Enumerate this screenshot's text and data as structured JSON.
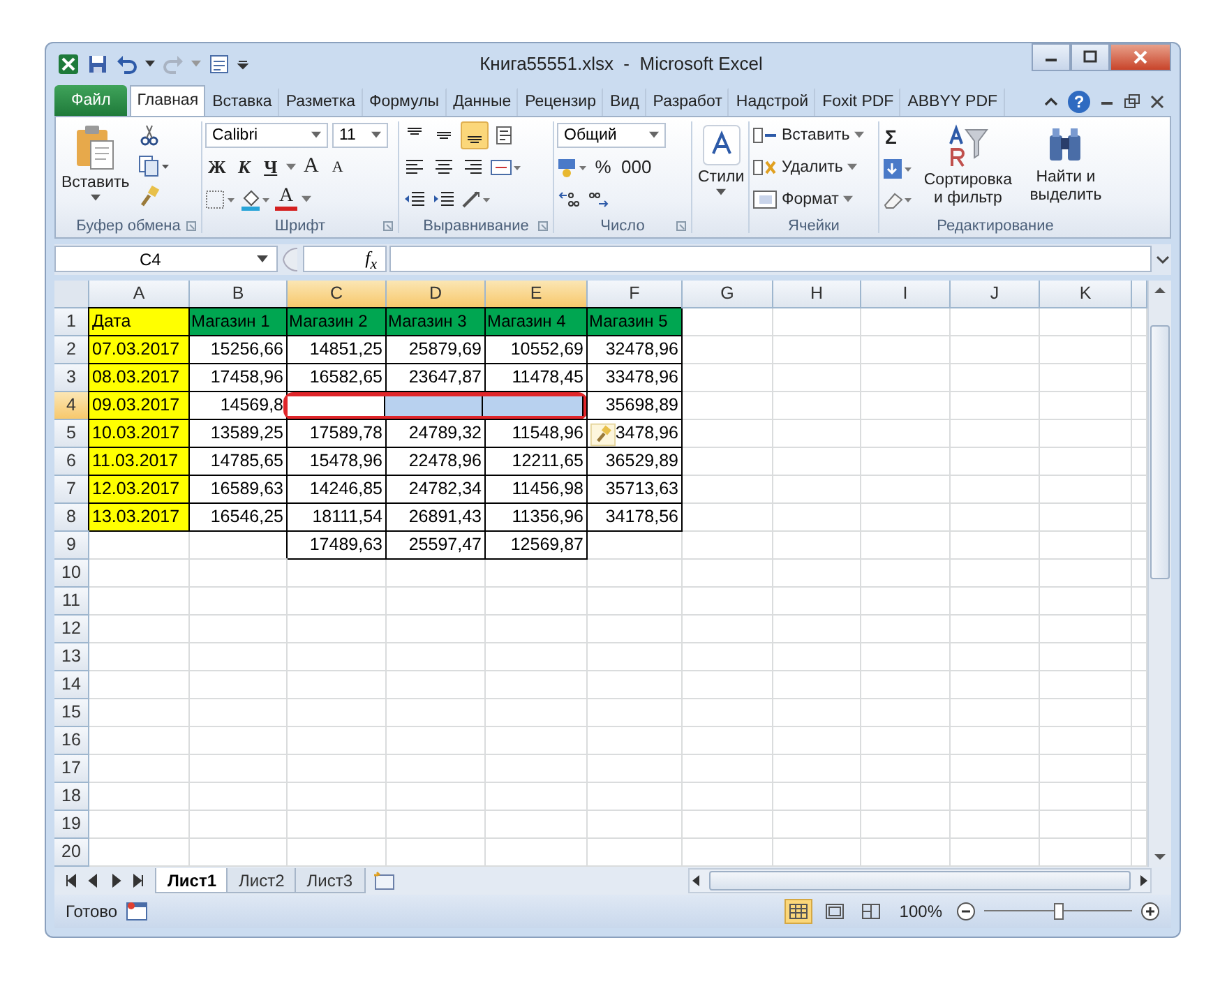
{
  "window": {
    "title": "Книга55551.xlsx  -  Microsoft Excel",
    "help": "?"
  },
  "ribbon_tabs": [
    {
      "label": "Файл",
      "kind": "file",
      "selected": false
    },
    {
      "label": "Главная",
      "kind": "tab",
      "selected": true
    },
    {
      "label": "Вставка",
      "kind": "tab",
      "selected": false
    },
    {
      "label": "Разметка",
      "kind": "tab",
      "selected": false
    },
    {
      "label": "Формулы",
      "kind": "tab",
      "selected": false
    },
    {
      "label": "Данные",
      "kind": "tab",
      "selected": false
    },
    {
      "label": "Рецензир",
      "kind": "tab",
      "selected": false
    },
    {
      "label": "Вид",
      "kind": "tab",
      "selected": false
    },
    {
      "label": "Разработ",
      "kind": "tab",
      "selected": false
    },
    {
      "label": "Надстрой",
      "kind": "tab",
      "selected": false
    },
    {
      "label": "Foxit PDF",
      "kind": "tab",
      "selected": false
    },
    {
      "label": "ABBYY PDF",
      "kind": "tab",
      "selected": false
    }
  ],
  "ribbon": {
    "clipboard": {
      "paste": "Вставить",
      "label": "Буфер обмена"
    },
    "font": {
      "name": "Calibri",
      "size": "11",
      "bold": "Ж",
      "italic": "К",
      "underline": "Ч",
      "grow": "A",
      "shrink": "A",
      "font_color_button": "A",
      "label": "Шрифт"
    },
    "alignment": {
      "label": "Выравнивание"
    },
    "number": {
      "format": "Общий",
      "percent": "%",
      "thousands": "000",
      "label": "Число"
    },
    "styles": {
      "button": "Стили"
    },
    "cells": {
      "insert": "Вставить",
      "delete": "Удалить",
      "format": "Формат",
      "label": "Ячейки"
    },
    "editing": {
      "sum": "Σ",
      "sort": "Сортировка и фильтр",
      "find": "Найти и выделить",
      "label": "Редактирование"
    }
  },
  "formula_bar": {
    "name_box": "C4",
    "fx": "f$_{x}$"
  },
  "sheet": {
    "columns": [
      {
        "label": "A",
        "selected": false
      },
      {
        "label": "B",
        "selected": false
      },
      {
        "label": "C",
        "selected": true
      },
      {
        "label": "D",
        "selected": true
      },
      {
        "label": "E",
        "selected": true
      },
      {
        "label": "F",
        "selected": false
      },
      {
        "label": "G",
        "selected": false
      },
      {
        "label": "H",
        "selected": false
      },
      {
        "label": "I",
        "selected": false
      },
      {
        "label": "J",
        "selected": false
      },
      {
        "label": "K",
        "selected": false
      }
    ],
    "rows": [
      {
        "number": "1",
        "selected": false,
        "cells": [
          {
            "text": "Дата",
            "kind": "date",
            "selected": false
          },
          {
            "text": "Магазин 1",
            "kind": "header",
            "selected": false
          },
          {
            "text": "Магазин 2",
            "kind": "header",
            "selected": false
          },
          {
            "text": "Магазин 3",
            "kind": "header",
            "selected": false
          },
          {
            "text": "Магазин 4",
            "kind": "header",
            "selected": false
          },
          {
            "text": "Магазин 5",
            "kind": "header",
            "selected": false
          }
        ]
      },
      {
        "number": "2",
        "selected": false,
        "cells": [
          {
            "text": "07.03.2017",
            "kind": "date",
            "selected": false
          },
          {
            "text": "15256,66",
            "kind": "number",
            "selected": false
          },
          {
            "text": "14851,25",
            "kind": "number",
            "selected": false
          },
          {
            "text": "25879,69",
            "kind": "number",
            "selected": false
          },
          {
            "text": "10552,69",
            "kind": "number",
            "selected": false
          },
          {
            "text": "32478,96",
            "kind": "number",
            "selected": false
          }
        ]
      },
      {
        "number": "3",
        "selected": false,
        "cells": [
          {
            "text": "08.03.2017",
            "kind": "date",
            "selected": false
          },
          {
            "text": "17458,96",
            "kind": "number",
            "selected": false
          },
          {
            "text": "16582,65",
            "kind": "number",
            "selected": false
          },
          {
            "text": "23647,87",
            "kind": "number",
            "selected": false
          },
          {
            "text": "11478,45",
            "kind": "number",
            "selected": false
          },
          {
            "text": "33478,96",
            "kind": "number",
            "selected": false
          }
        ]
      },
      {
        "number": "4",
        "selected": true,
        "cells": [
          {
            "text": "09.03.2017",
            "kind": "date",
            "selected": false
          },
          {
            "text": "14569,8",
            "kind": "number",
            "selected": false
          },
          {
            "kind": "active",
            "selected": true
          },
          {
            "kind": "number",
            "selected": true
          },
          {
            "kind": "number",
            "selected": true
          },
          {
            "text": "35698,89",
            "kind": "number",
            "selected": false
          }
        ]
      },
      {
        "number": "5",
        "selected": false,
        "cells": [
          {
            "text": "10.03.2017",
            "kind": "date",
            "selected": false
          },
          {
            "text": "13589,25",
            "kind": "number",
            "selected": false
          },
          {
            "text": "17589,78",
            "kind": "number",
            "selected": false
          },
          {
            "text": "24789,32",
            "kind": "number",
            "selected": false
          },
          {
            "text": "11548,96",
            "kind": "number",
            "selected": false
          },
          {
            "text": "3478,96",
            "kind": "number",
            "selected": false
          }
        ]
      },
      {
        "number": "6",
        "selected": false,
        "cells": [
          {
            "text": "11.03.2017",
            "kind": "date",
            "selected": false
          },
          {
            "text": "14785,65",
            "kind": "number",
            "selected": false
          },
          {
            "text": "15478,96",
            "kind": "number",
            "selected": false
          },
          {
            "text": "22478,96",
            "kind": "number",
            "selected": false
          },
          {
            "text": "12211,65",
            "kind": "number",
            "selected": false
          },
          {
            "text": "36529,89",
            "kind": "number",
            "selected": false
          }
        ]
      },
      {
        "number": "7",
        "selected": false,
        "cells": [
          {
            "text": "12.03.2017",
            "kind": "date",
            "selected": false
          },
          {
            "text": "16589,63",
            "kind": "number",
            "selected": false
          },
          {
            "text": "14246,85",
            "kind": "number",
            "selected": false
          },
          {
            "text": "24782,34",
            "kind": "number",
            "selected": false
          },
          {
            "text": "11456,98",
            "kind": "number",
            "selected": false
          },
          {
            "text": "35713,63",
            "kind": "number",
            "selected": false
          }
        ]
      },
      {
        "number": "8",
        "selected": false,
        "cells": [
          {
            "text": "13.03.2017",
            "kind": "date",
            "selected": false
          },
          {
            "text": "16546,25",
            "kind": "number",
            "selected": false
          },
          {
            "text": "18111,54",
            "kind": "number",
            "selected": false
          },
          {
            "text": "26891,43",
            "kind": "number",
            "selected": false
          },
          {
            "text": "11356,96",
            "kind": "number",
            "selected": false
          },
          {
            "text": "34178,56",
            "kind": "number",
            "selected": false
          }
        ]
      },
      {
        "number": "9",
        "selected": false,
        "cells": [
          {
            "kind": "blank",
            "selected": false
          },
          {
            "kind": "blank",
            "selected": false
          },
          {
            "text": "17489,63",
            "kind": "number",
            "selected": false
          },
          {
            "text": "25597,47",
            "kind": "number",
            "selected": false
          },
          {
            "text": "12569,87",
            "kind": "number",
            "selected": false
          }
        ]
      },
      {
        "number": "10",
        "selected": false
      },
      {
        "number": "11",
        "selected": false
      },
      {
        "number": "12",
        "selected": false
      },
      {
        "number": "13",
        "selected": false
      },
      {
        "number": "14",
        "selected": false
      },
      {
        "number": "15",
        "selected": false
      },
      {
        "number": "16",
        "selected": false
      },
      {
        "number": "17",
        "selected": false
      },
      {
        "number": "18",
        "selected": false
      },
      {
        "number": "19",
        "selected": false
      },
      {
        "number": "20",
        "selected": false
      }
    ]
  },
  "sheet_tabs": [
    {
      "label": "Лист1",
      "selected": true
    },
    {
      "label": "Лист2",
      "selected": false
    },
    {
      "label": "Лист3",
      "selected": false
    }
  ],
  "status_bar": {
    "status": "Готово",
    "views": [
      {
        "kind": "normal",
        "selected": true
      },
      {
        "kind": "layout",
        "selected": false
      },
      {
        "kind": "pagebreak",
        "selected": false
      }
    ],
    "zoom": "100%",
    "zoom_slider": {
      "level": 0.5
    }
  }
}
